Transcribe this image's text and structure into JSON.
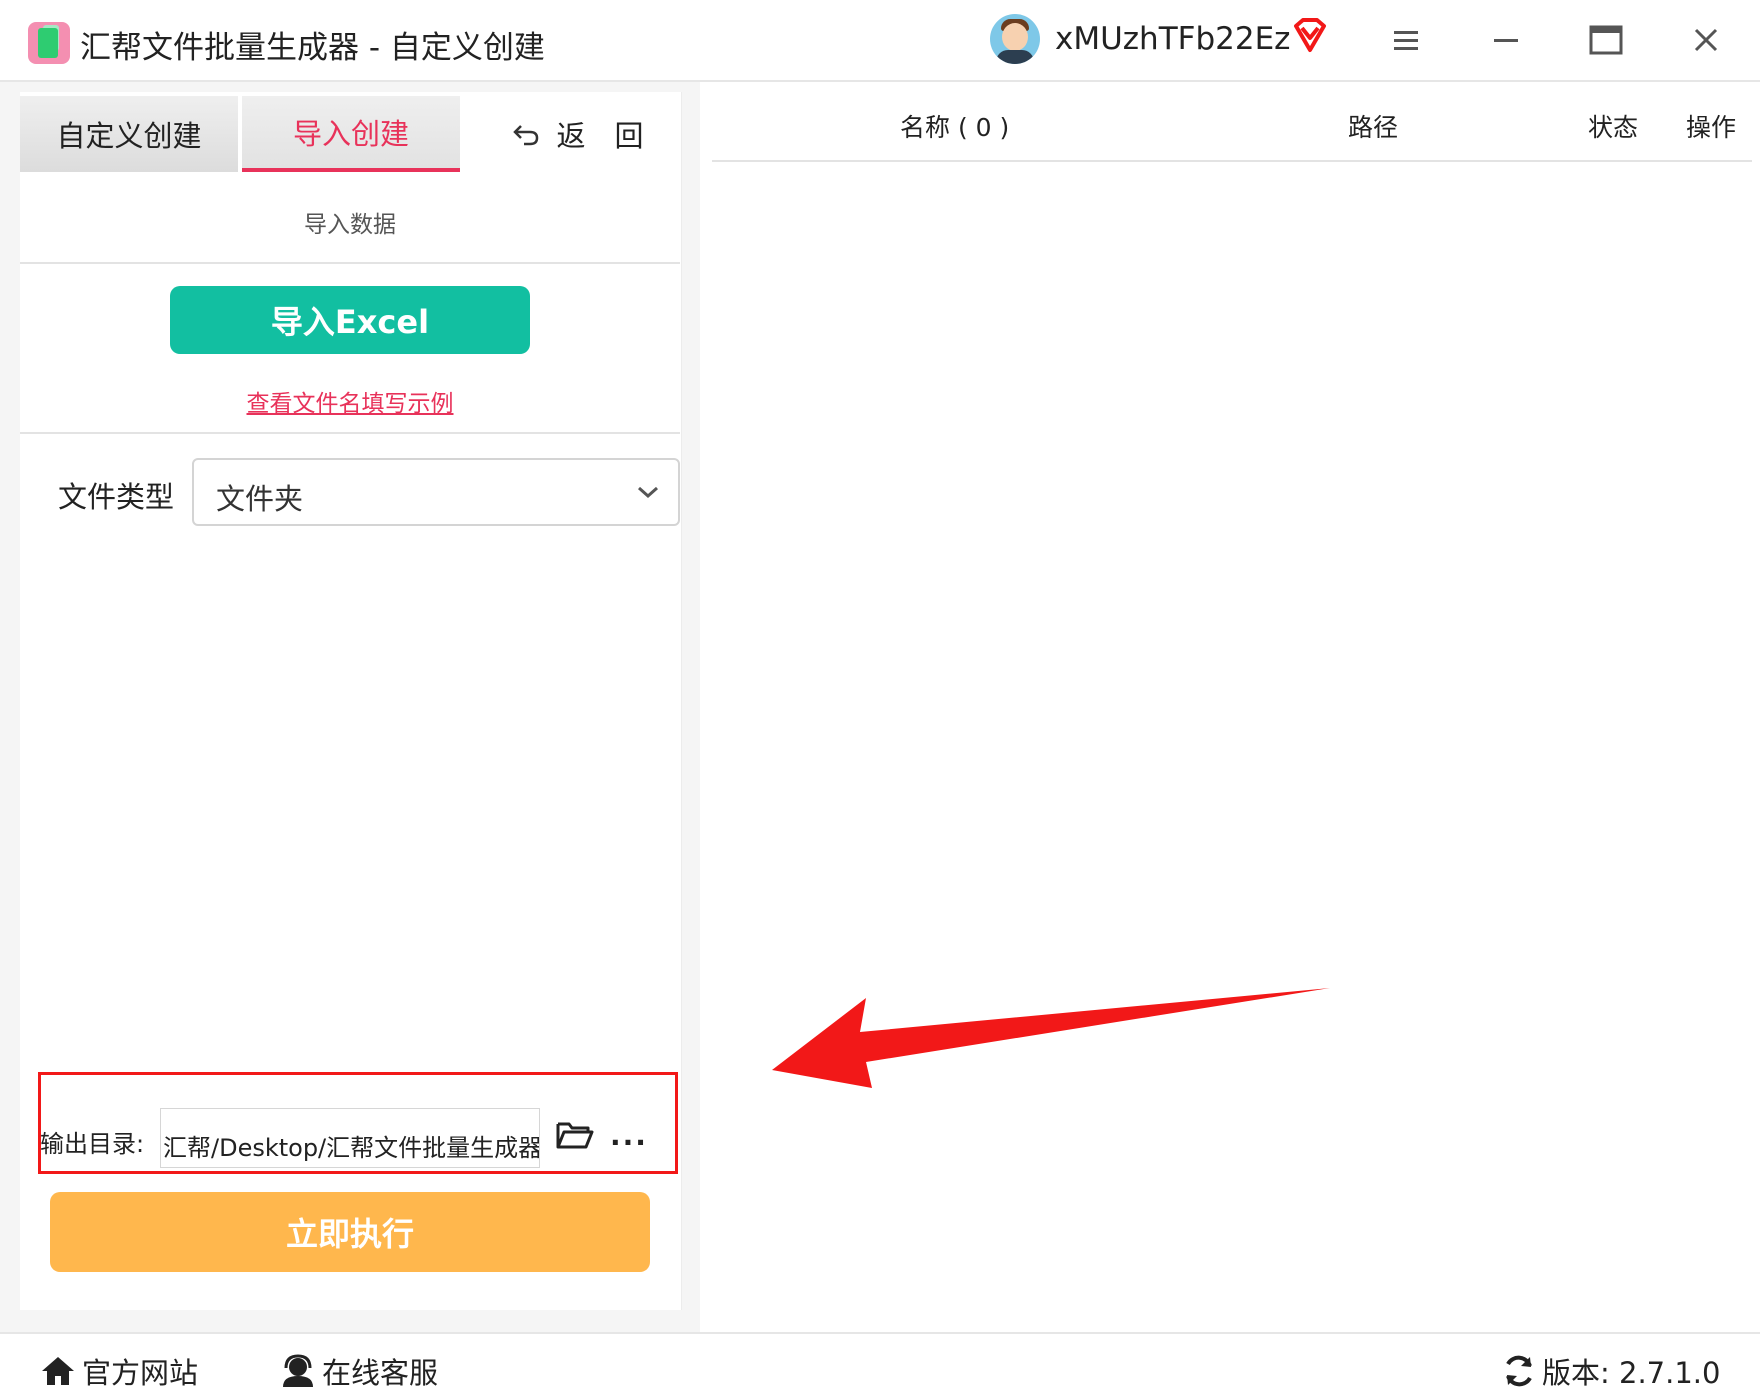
{
  "window": {
    "title": "汇帮文件批量生成器 - 自定义创建",
    "username": "xMUzhTFb22Ez",
    "icons": {
      "app": "app-icon",
      "avatar": "avatar",
      "vip": "vip-badge-icon",
      "menu": "menu-icon",
      "minimize": "minimize-icon",
      "maximize": "maximize-icon",
      "close": "close-icon"
    }
  },
  "left_panel": {
    "tabs": [
      {
        "label": "自定义创建",
        "active": false
      },
      {
        "label": "导入创建",
        "active": true
      }
    ],
    "back_label": "返　回",
    "section_label": "导入数据",
    "import_button": "导入Excel",
    "example_link": "查看文件名填写示例",
    "file_type": {
      "label": "文件类型",
      "value": "文件夹"
    },
    "output": {
      "label": "输出目录:",
      "path": "汇帮/Desktop/汇帮文件批量生成器",
      "more": "···"
    },
    "run_button": "立即执行"
  },
  "table": {
    "columns": [
      "名称 ( 0 )",
      "路径",
      "状态",
      "操作"
    ],
    "rows": []
  },
  "footer": {
    "website": "官方网站",
    "support": "在线客服",
    "version": "版本: 2.7.1.0"
  },
  "colors": {
    "accent_pink": "#e8325a",
    "import_green": "#12bfa1",
    "run_orange": "#ffb74d",
    "highlight_red": "#f21818"
  }
}
